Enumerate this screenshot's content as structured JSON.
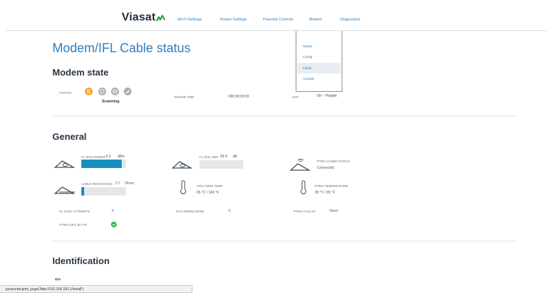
{
  "brand": {
    "name": "Viasat",
    "accent": "#1a9e3e"
  },
  "nav": {
    "wifi_settings": "Wi-Fi Settings",
    "router_settings": "Router Settings",
    "parental_controls": "Parental Controls",
    "modem": "Modem",
    "diagnostics": "Diagnostics"
  },
  "modem_menu": {
    "items": [
      "Status",
      "Config",
      "Install",
      "Activate"
    ],
    "active": "Install"
  },
  "page": {
    "title": "Modem/IFL Cable status"
  },
  "modem_state": {
    "heading": "Modem state",
    "status_label": "STATUS",
    "status_text": "Scanning",
    "online_time_label": "ONLINE TIME",
    "online_time_value": "000:00:00:00",
    "led_label": "LED",
    "led_value": "On - Purple",
    "status_colors": {
      "active": "#f2a52a",
      "inactive": "#a9aeb3"
    }
  },
  "general": {
    "heading": "General",
    "fl_rx_power_label": "FL (RX) POWER",
    "fl_rx_power_value": "-0.9",
    "fl_rx_power_unit": "dBm",
    "fl_rx_power_level": 0.9,
    "fl_rx_snr_label": "FL (RX) SNR",
    "fl_rx_snr_value": "-99.9",
    "fl_rx_snr_unit": "dB",
    "fl_rx_snr_level": 0.0,
    "ptria_comm_status_label": "PTRIA COMM STATUS",
    "ptria_comm_status_value": "Connected",
    "cable_resistance_label": "CABLE RESISTANCE",
    "cable_resistance_value": "2.7",
    "cable_resistance_unit": "Ohms",
    "cable_resistance_level": 0.06,
    "cpu_core_temp_label": "CPU CORE TEMP",
    "cpu_core_temp_value": "65 °C / 149 °F",
    "ptria_temperature_label": "PTRIA TEMPERATURE",
    "ptria_temperature_value": "35 °C / 95 °F",
    "fl_sync_attempts_label": "FL SYNC ATTEMPTS",
    "fl_sync_attempts_value": "6",
    "fan_speed_label": "FAN SPEED (RPM)",
    "fan_speed_value": "0",
    "ptria_faults_label": "PTRIA FAULTS",
    "ptria_faults_value": "None",
    "ptria_gps_3d_fix_label": "PTRIA GPS 3D FIX",
    "ptria_gps_3d_fix_ok": true,
    "bar_color": "#168fbd",
    "ok_color": "#2db34a"
  },
  "identification": {
    "heading": "Identification",
    "idu_label": "IDU"
  },
  "browser_status": {
    "text": "javascript:goto_page('http://192.168.100.1/install')"
  }
}
